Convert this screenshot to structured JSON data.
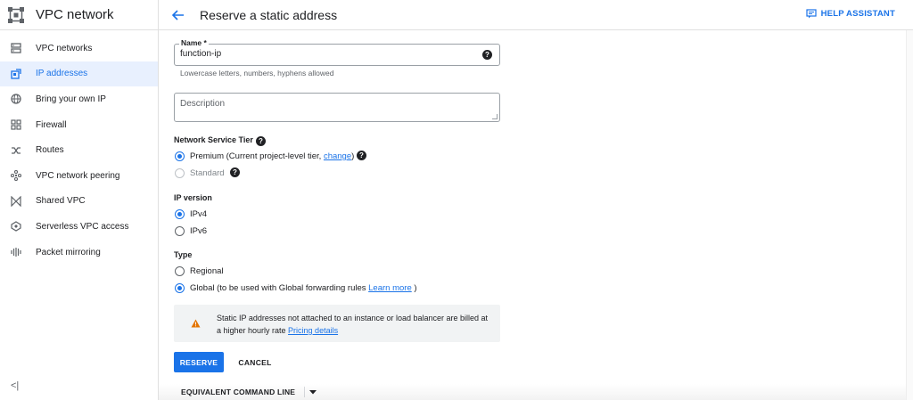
{
  "sidebar": {
    "title": "VPC network",
    "items": [
      {
        "label": "VPC networks",
        "icon": "vpc-networks-icon"
      },
      {
        "label": "IP addresses",
        "icon": "ip-addresses-icon",
        "active": true
      },
      {
        "label": "Bring your own IP",
        "icon": "globe-icon"
      },
      {
        "label": "Firewall",
        "icon": "firewall-icon"
      },
      {
        "label": "Routes",
        "icon": "routes-icon"
      },
      {
        "label": "VPC network peering",
        "icon": "peering-icon"
      },
      {
        "label": "Shared VPC",
        "icon": "shared-vpc-icon"
      },
      {
        "label": "Serverless VPC access",
        "icon": "serverless-icon"
      },
      {
        "label": "Packet mirroring",
        "icon": "packet-mirroring-icon"
      }
    ],
    "collapse_glyph": "<|"
  },
  "header": {
    "title": "Reserve a static address",
    "help_label": "HELP ASSISTANT"
  },
  "form": {
    "name_label": "Name *",
    "name_value": "function-ip",
    "name_hint": "Lowercase letters, numbers, hyphens allowed",
    "description_placeholder": "Description",
    "tier_label": "Network Service Tier",
    "tier_premium_prefix": "Premium (Current project-level tier, ",
    "tier_premium_link": "change",
    "tier_premium_suffix": ")",
    "tier_standard": "Standard",
    "ip_version_label": "IP version",
    "ipv4": "IPv4",
    "ipv6": "IPv6",
    "type_label": "Type",
    "type_regional": "Regional",
    "type_global_prefix": "Global (to be used with Global forwarding rules ",
    "type_global_link": "Learn more",
    "type_global_suffix": " )",
    "warning_text": "Static IP addresses not attached to an instance or load balancer are billed at a higher hourly rate ",
    "warning_link": "Pricing details",
    "reserve_label": "RESERVE",
    "cancel_label": "CANCEL",
    "equivalent_label": "EQUIVALENT COMMAND LINE"
  },
  "colors": {
    "accent": "#1a73e8",
    "warning": "#e37400",
    "active_bg": "#e8f0fe"
  }
}
